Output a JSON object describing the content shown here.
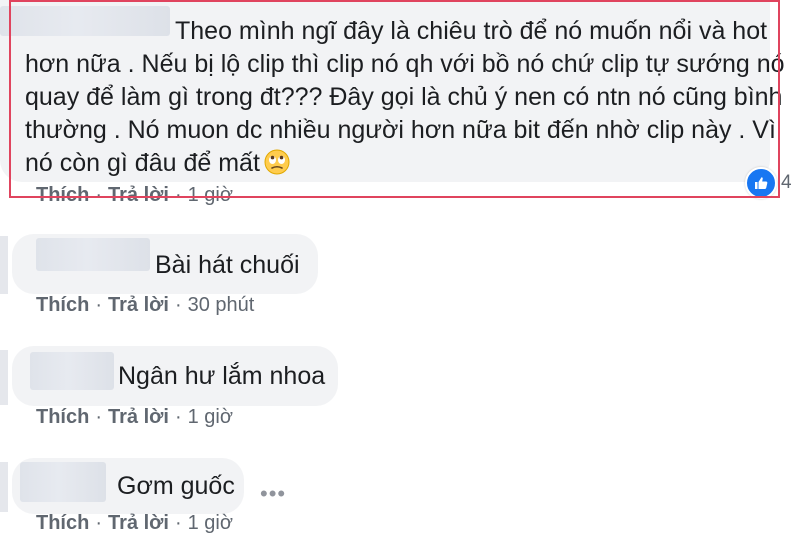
{
  "comments": [
    {
      "lines": [
        "Theo mình ngĩ đây là chiêu trò để nó muốn nổi và hot",
        "hơn nữa . Nếu bị lộ clip thì clip nó qh với bồ nó chứ clip tự sướng nó",
        "quay để làm gì trong đt??? Đây gọi là chủ ý nen có ntn nó cũng bình",
        "thường . Nó muon dc nhiều người hơn nữa bit đến nhờ clip này . Vì",
        "nó còn gì đâu để mất"
      ],
      "emoji": "rolling-eyes-emoji",
      "like_count": "4",
      "actions": {
        "like": "Thích",
        "reply": "Trả lời",
        "time": "1 giờ"
      }
    },
    {
      "text": "Bài hát chuối",
      "actions": {
        "like": "Thích",
        "reply": "Trả lời",
        "time": "30 phút"
      }
    },
    {
      "text": "Ngân hư lắm nhoa",
      "actions": {
        "like": "Thích",
        "reply": "Trả lời",
        "time": "1 giờ"
      }
    },
    {
      "text": "Gơm guốc",
      "more_icon": "more-options-icon",
      "actions": {
        "like": "Thích",
        "reply": "Trả lời",
        "time": "1 giờ"
      }
    }
  ],
  "separator": "·",
  "colors": {
    "highlight": "#e0445e",
    "like_blue": "#1877f2",
    "bubble": "#f2f3f5",
    "meta": "#606770"
  }
}
